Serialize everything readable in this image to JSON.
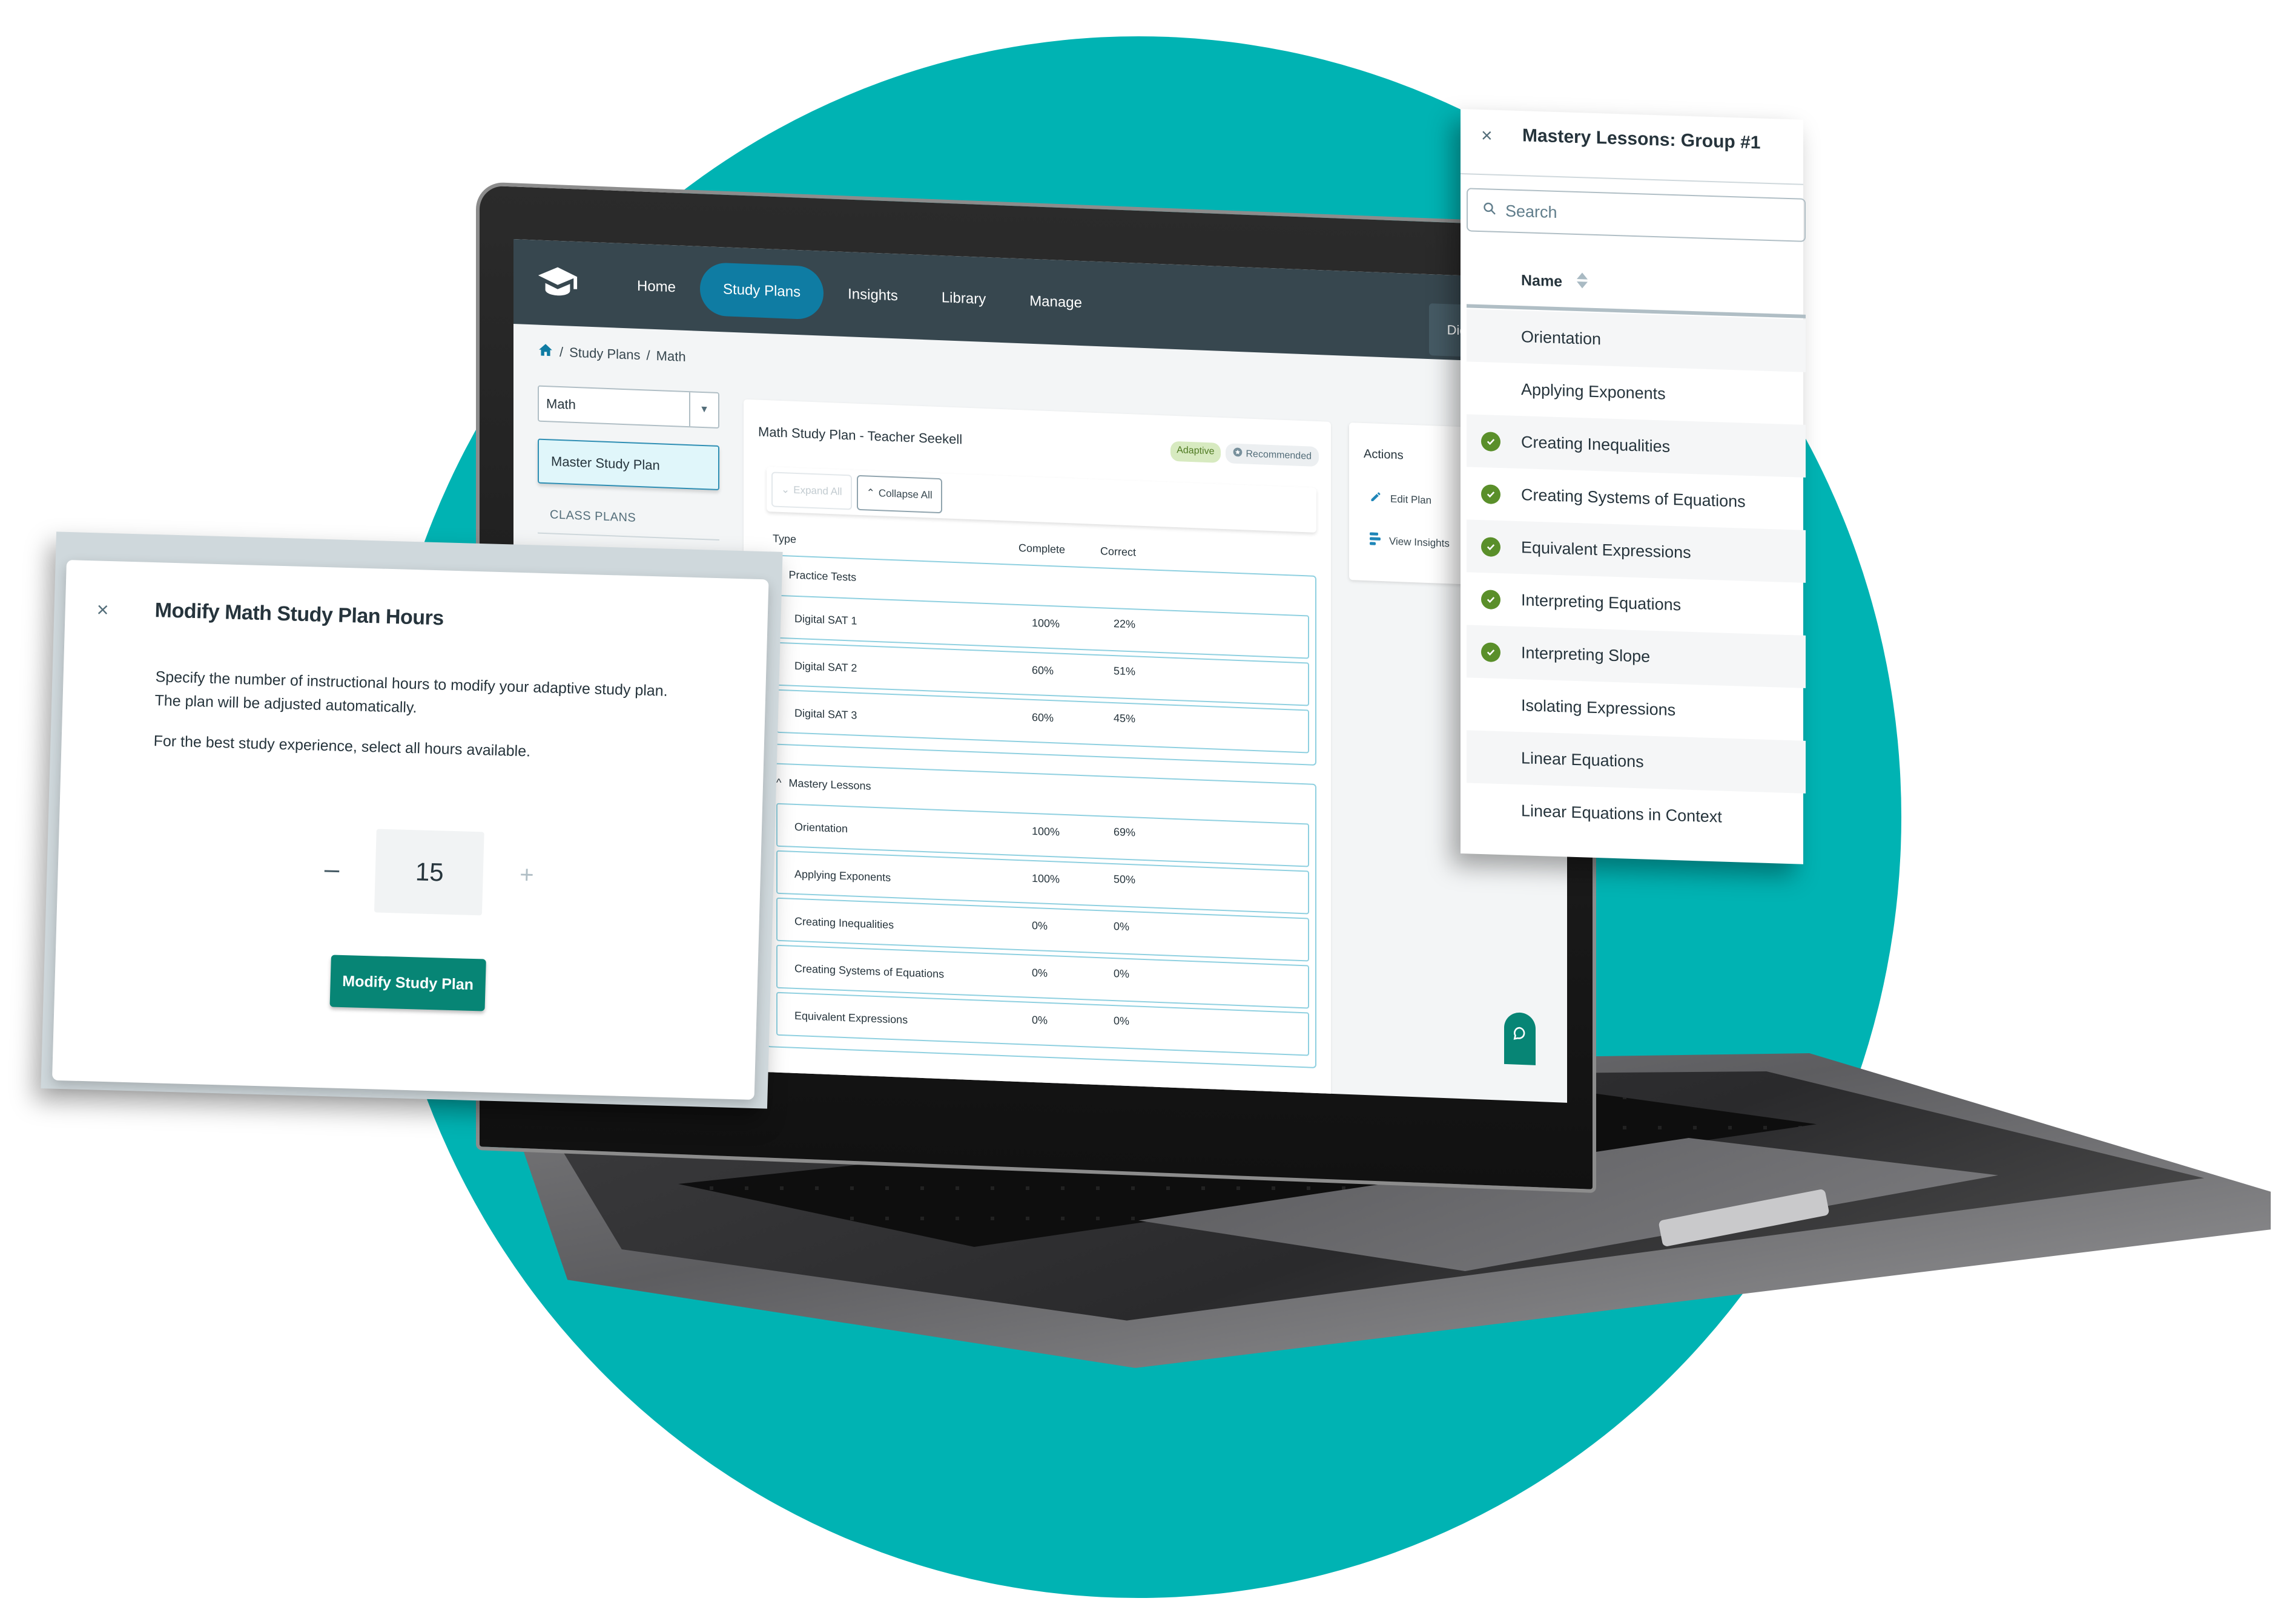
{
  "app": {
    "nav": {
      "items": [
        {
          "label": "Home",
          "active": false
        },
        {
          "label": "Study Plans",
          "active": true
        },
        {
          "label": "Insights",
          "active": false
        },
        {
          "label": "Library",
          "active": false
        },
        {
          "label": "Manage",
          "active": false
        }
      ],
      "program_select": "Digital SAT",
      "logo_icon": "graduation-cap-icon"
    },
    "breadcrumb": {
      "home_icon": "home-icon",
      "items": [
        "Study Plans",
        "Math"
      ],
      "separator": "/"
    },
    "sidebar": {
      "subject_select": "Math",
      "master_plan_label": "Master Study Plan",
      "class_plans_label": "CLASS PLANS"
    },
    "plan": {
      "title": "Math Study Plan - Teacher Seekell",
      "badges": {
        "adaptive": "Adaptive",
        "recommended": "Recommended"
      },
      "toolbar": {
        "expand_all": "Expand All",
        "collapse_all": "Collapse All"
      },
      "columns": {
        "type": "Type",
        "complete": "Complete",
        "correct": "Correct"
      },
      "groups": [
        {
          "title": "Practice Tests",
          "rows": [
            {
              "name": "Digital SAT 1",
              "complete": "100%",
              "correct": "22%"
            },
            {
              "name": "Digital SAT 2",
              "complete": "60%",
              "correct": "51%"
            },
            {
              "name": "Digital SAT 3",
              "complete": "60%",
              "correct": "45%"
            }
          ]
        },
        {
          "title": "Mastery Lessons",
          "rows": [
            {
              "name": "Orientation",
              "complete": "100%",
              "correct": "69%"
            },
            {
              "name": "Applying Exponents",
              "complete": "100%",
              "correct": "50%"
            },
            {
              "name": "Creating Inequalities",
              "complete": "0%",
              "correct": "0%"
            },
            {
              "name": "Creating Systems of Equations",
              "complete": "0%",
              "correct": "0%"
            },
            {
              "name": "Equivalent Expressions",
              "complete": "0%",
              "correct": "0%"
            }
          ]
        }
      ]
    },
    "actions": {
      "title": "Actions",
      "items": [
        {
          "label": "Edit Plan",
          "icon": "pencil-icon"
        },
        {
          "label": "View Insights",
          "icon": "insights-bars-icon"
        }
      ]
    },
    "chat_icon": "chat-bubble-icon"
  },
  "modal": {
    "title": "Modify Math Study Plan Hours",
    "description_lines": [
      "Specify the number of instructional hours to modify your adaptive study plan.",
      "The plan will be adjusted automatically."
    ],
    "hint": "For the best study experience, select all hours available.",
    "hours_value": "15",
    "decrement_label": "–",
    "increment_label": "+",
    "submit_label": "Modify Study Plan",
    "close_label": "×"
  },
  "panel": {
    "title": "Mastery Lessons: Group #1",
    "close_label": "×",
    "search_placeholder": "Search",
    "column_name": "Name",
    "lessons": [
      {
        "name": "Orientation",
        "completed": false
      },
      {
        "name": "Applying Exponents",
        "completed": false
      },
      {
        "name": "Creating Inequalities",
        "completed": true
      },
      {
        "name": "Creating Systems of Equations",
        "completed": true
      },
      {
        "name": "Equivalent Expressions",
        "completed": true
      },
      {
        "name": "Interpreting Equations",
        "completed": true
      },
      {
        "name": "Interpreting Slope",
        "completed": true
      },
      {
        "name": "Isolating Expressions",
        "completed": false
      },
      {
        "name": "Linear Equations",
        "completed": false
      },
      {
        "name": "Linear Equations in Context",
        "completed": false
      }
    ]
  },
  "colors": {
    "background_circle": "#00b3b3",
    "nav_bar": "#37474f",
    "nav_active": "#0f7ca3",
    "primary_button": "#078575",
    "completed_check": "#5a8f2a",
    "row_border": "#8fd0e0"
  }
}
